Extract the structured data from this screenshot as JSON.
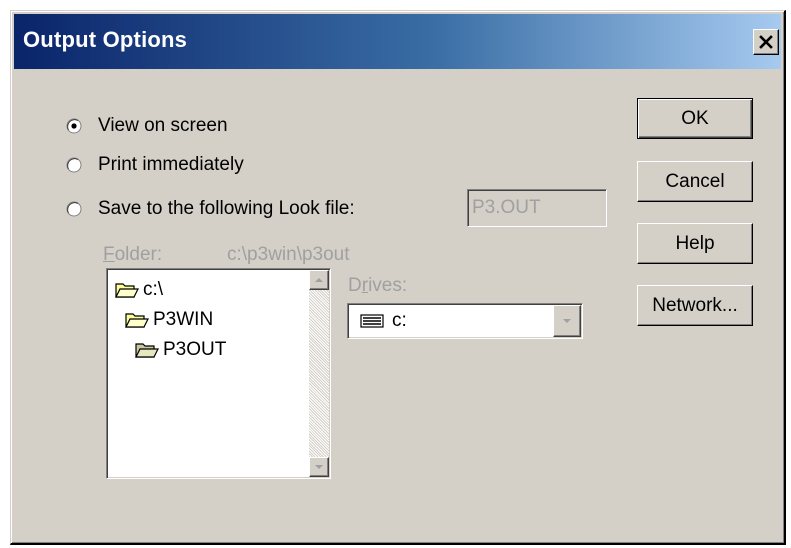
{
  "window": {
    "title": "Output Options"
  },
  "output_mode": {
    "selected": "view_on_screen",
    "options": [
      {
        "id": "view_on_screen",
        "label": "View on screen"
      },
      {
        "id": "print_immediately",
        "label": "Print immediately"
      },
      {
        "id": "save_to_file",
        "label": "Save to the following Look file:"
      }
    ],
    "look_file_value": "P3.OUT"
  },
  "folder": {
    "label": "Folder:",
    "label_underline": "F",
    "path": "c:\\p3win\\p3out",
    "tree": [
      {
        "label": "c:\\",
        "icon": "open-folder-icon"
      },
      {
        "label": "P3WIN",
        "icon": "open-folder-icon"
      },
      {
        "label": "P3OUT",
        "icon": "open-folder-icon"
      }
    ]
  },
  "drives": {
    "label": "Drives:",
    "selected": "c:",
    "icon": "hard-drive-icon"
  },
  "buttons": {
    "ok": "OK",
    "cancel": "Cancel",
    "help": "Help",
    "network": "Network..."
  },
  "colors": {
    "title_gradient_start": "#0a246a",
    "title_gradient_end": "#a6caf0",
    "face": "#d4d0c8",
    "disabled_text": "#a0a0a0",
    "folder_fill": "#ffff99"
  }
}
